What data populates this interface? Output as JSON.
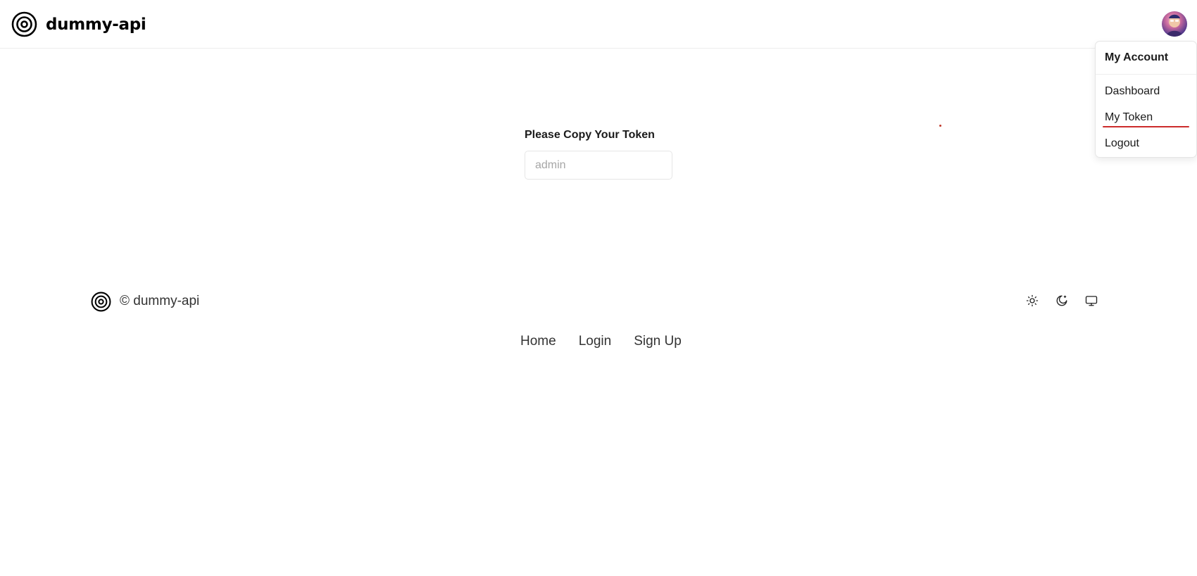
{
  "header": {
    "brand_name": "dummy-api"
  },
  "account_menu": {
    "title": "My Account",
    "items": [
      {
        "label": "Dashboard"
      },
      {
        "label": "My Token"
      },
      {
        "label": "Logout"
      }
    ],
    "highlighted_item": "My Token",
    "highlight_color": "#cc2b2b"
  },
  "token": {
    "label": "Please Copy Your Token",
    "placeholder": "admin"
  },
  "footer": {
    "copyright": "© dummy-api",
    "theme_icons": [
      "sun-icon",
      "moon-icon",
      "monitor-icon"
    ],
    "nav": [
      {
        "label": "Home"
      },
      {
        "label": "Login"
      },
      {
        "label": "Sign Up"
      }
    ]
  }
}
